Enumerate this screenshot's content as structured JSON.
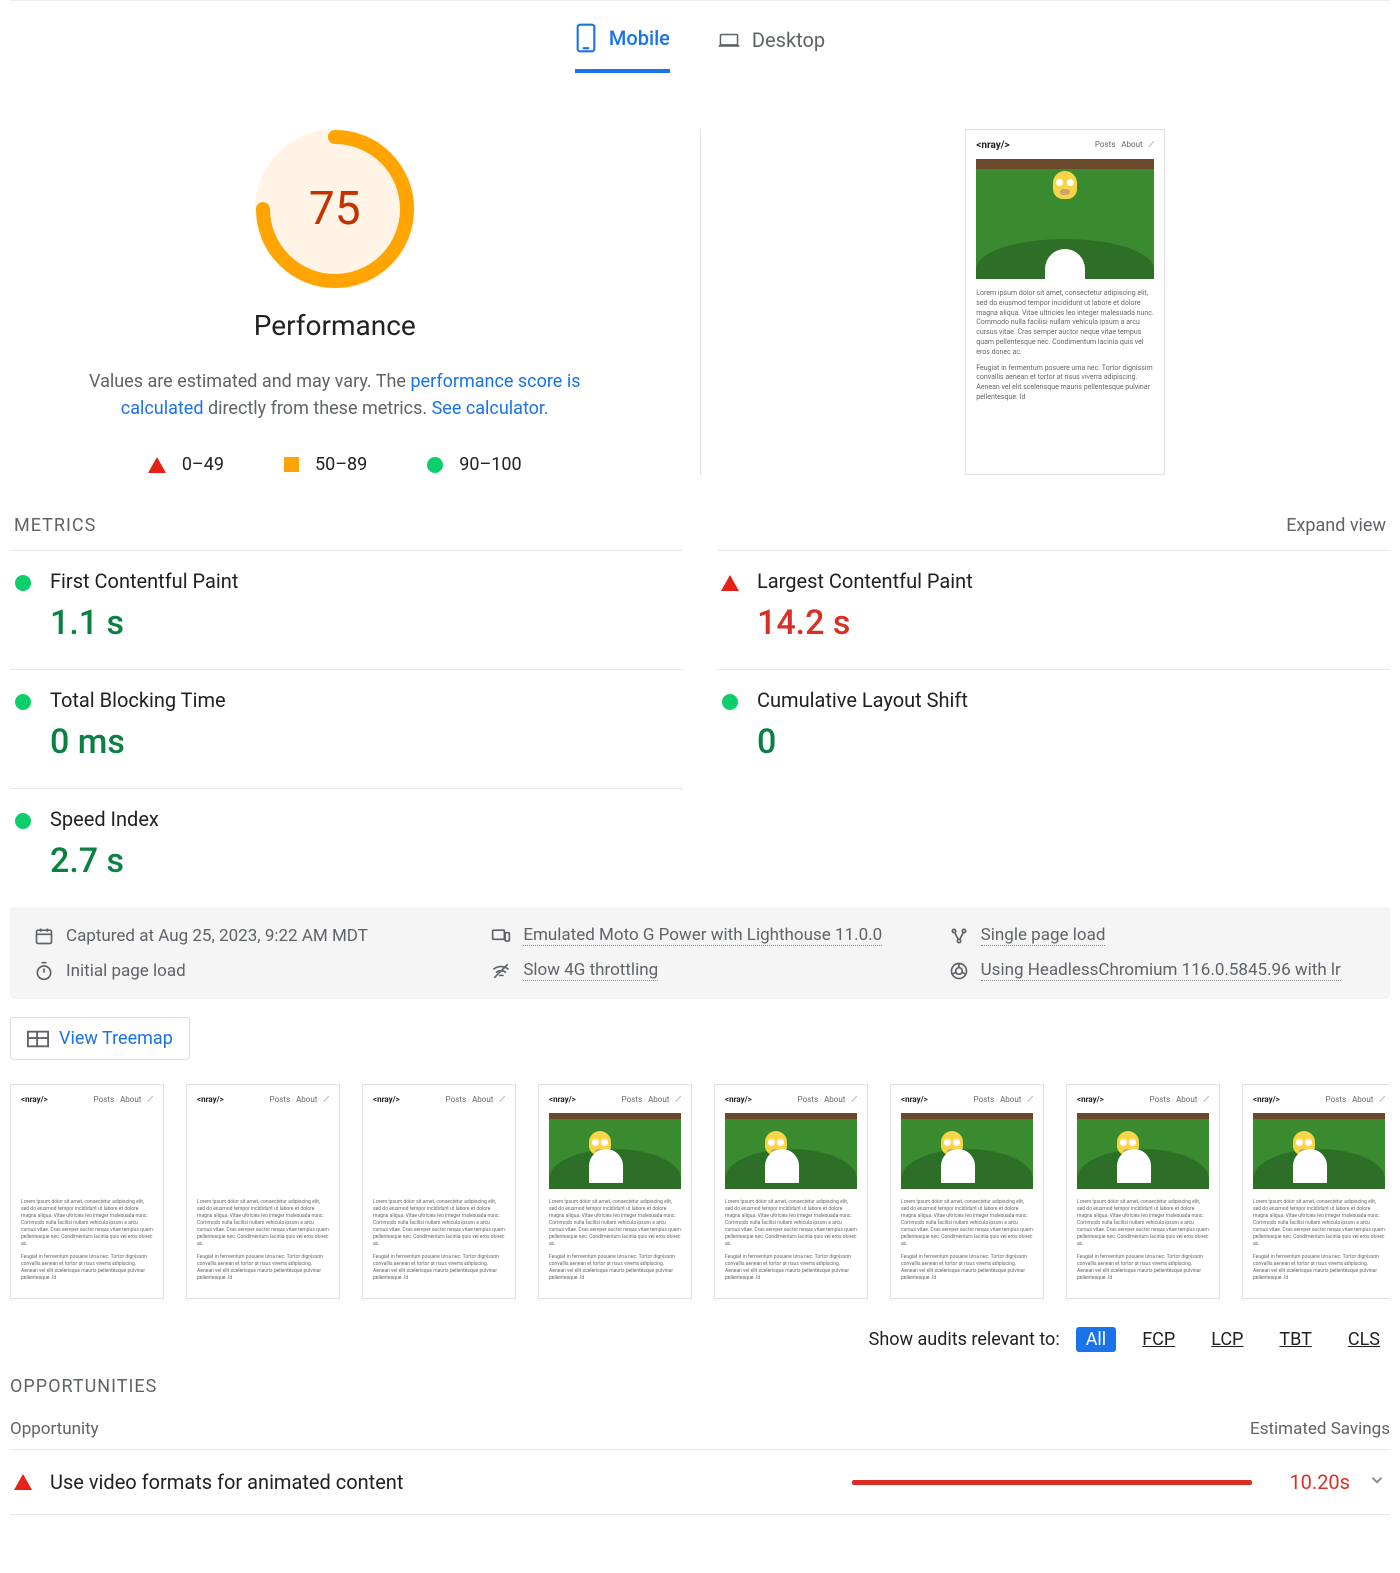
{
  "tabs": {
    "mobile": "Mobile",
    "desktop": "Desktop"
  },
  "gauge": {
    "score": "75",
    "label": "Performance",
    "arc_fraction": 0.75
  },
  "desc": {
    "pre": "Values are estimated and may vary. The ",
    "link1": "performance score is calculated",
    "mid": " directly from these metrics. ",
    "link2": "See calculator."
  },
  "legend": {
    "r0": "0–49",
    "r1": "50–89",
    "r2": "90–100"
  },
  "screenshot": {
    "logo": "<nray/>",
    "nav": [
      "Posts",
      "About"
    ],
    "p1": "Lorem ipsum dolor sit amet, consectetur adipiscing elit, sed do eiusmod tempor incididunt ut labore et dolore magna aliqua. Vitae ultricies leo integer malesuada nunc. Commodo nulla facilisi nullam vehicula ipsum a arcu cursus vitae. Cras semper auctor neque vitae tempus quam pellentesque nec. Condimentum lacinia quis vel eros donec ac.",
    "p2": "Feugiat in fermentum posuere urna nec. Tortor dignissim convallis aenean et tortor at risus viverra adipiscing. Aenean vel elit scelerisque mauris pellentesque pulvinar pellentesque. Id"
  },
  "metrics_header": {
    "title": "METRICS",
    "expand": "Expand view"
  },
  "metrics": {
    "fcp": {
      "name": "First Contentful Paint",
      "value": "1.1 s",
      "status": "green"
    },
    "lcp": {
      "name": "Largest Contentful Paint",
      "value": "14.2 s",
      "status": "red"
    },
    "tbt": {
      "name": "Total Blocking Time",
      "value": "0 ms",
      "status": "green"
    },
    "cls": {
      "name": "Cumulative Layout Shift",
      "value": "0",
      "status": "green"
    },
    "si": {
      "name": "Speed Index",
      "value": "2.7 s",
      "status": "green"
    }
  },
  "env": {
    "captured": "Captured at Aug 25, 2023, 9:22 AM MDT",
    "device": "Emulated Moto G Power with Lighthouse 11.0.0",
    "load": "Single page load",
    "initial": "Initial page load",
    "network": "Slow 4G throttling",
    "browser": "Using HeadlessChromium 116.0.5845.96 with lr"
  },
  "treemap": "View Treemap",
  "audit_filter": {
    "label": "Show audits relevant to:",
    "items": [
      "All",
      "FCP",
      "LCP",
      "TBT",
      "CLS"
    ]
  },
  "opportunities": {
    "section": "OPPORTUNITIES",
    "col_opp": "Opportunity",
    "col_sav": "Estimated Savings",
    "row": {
      "name": "Use video formats for animated content",
      "savings": "10.20s"
    }
  }
}
